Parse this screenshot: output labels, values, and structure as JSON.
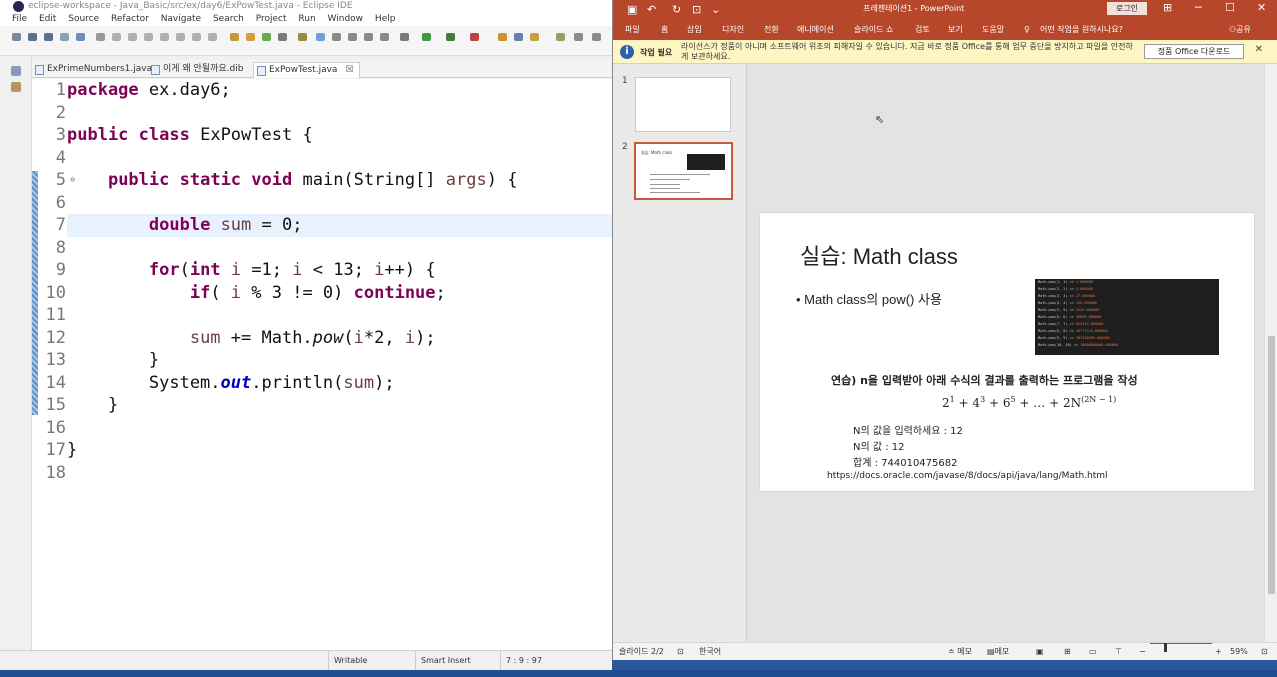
{
  "eclipse": {
    "title": "eclipse-workspace - Java_Basic/src/ex/day6/ExPowTest.java - Eclipse IDE",
    "menu": [
      "File",
      "Edit",
      "Source",
      "Refactor",
      "Navigate",
      "Search",
      "Project",
      "Run",
      "Window",
      "Help"
    ],
    "tabs": [
      {
        "label": "ExPrimeNumbers1.java"
      },
      {
        "label": "이게 왜 안될까요.dib"
      },
      {
        "label": "ExPowTest.java",
        "close": "☒"
      }
    ],
    "line_numbers": [
      "1",
      "2",
      "3",
      "4",
      "5",
      "6",
      "7",
      "8",
      "9",
      "10",
      "11",
      "12",
      "13",
      "14",
      "15",
      "16",
      "17",
      "18"
    ],
    "fold_marker": "⊖",
    "status": {
      "writable": "Writable",
      "insert_mode": "Smart Insert",
      "position": "7 : 9 : 97"
    }
  },
  "ppt": {
    "doc_title": "프레젠테이션1 - PowerPoint",
    "login": "로그인",
    "ribbon_tabs": [
      "파일",
      "홈",
      "삽입",
      "디자인",
      "전환",
      "애니메이션",
      "슬라이드 쇼",
      "검토",
      "보기",
      "도움말"
    ],
    "tell_me": "어떤 작업을 원하시나요?",
    "share": "공유",
    "warning": {
      "title": "작업 필요",
      "message": "라이선스가 정품이 아니며 소프트웨어 위조의 피해자일 수 있습니다. 지금 바로 정품 Office를 통해 업무 중단을 방지하고 파일을 안전하게 보관하세요.",
      "button": "정품 Office 다운로드",
      "close": "✕"
    },
    "thumbnails": [
      {
        "number": "1"
      },
      {
        "number": "2",
        "mini_title": "실습: Math class"
      }
    ],
    "slide": {
      "title": "실습: Math class",
      "bullet": "• Math class의 pow() 사용",
      "console_lines": [
        [
          "Math.pow(1, 1) => ",
          "1.000000"
        ],
        [
          "Math.pow(2, 2) => ",
          "4.000000"
        ],
        [
          "Math.pow(3, 3) => ",
          "27.000000"
        ],
        [
          "Math.pow(4, 4) => ",
          "256.000000"
        ],
        [
          "Math.pow(5, 5) => ",
          "3125.000000"
        ],
        [
          "Math.pow(6, 6) => ",
          "46656.000000"
        ],
        [
          "Math.pow(7, 7) => ",
          "823543.000000"
        ],
        [
          "Math.pow(8, 8) => ",
          "16777216.000000"
        ],
        [
          "Math.pow(9, 9) => ",
          "387420489.000000"
        ],
        [
          "Math.pow(10, 10) => ",
          "10000000000.000000"
        ]
      ],
      "exercise": "연습) n을 입력받아 아래 수식의 결과를 출력하는 프로그램을 작성",
      "formula": {
        "t1": "2",
        "e1": "1",
        "t2": " + 4",
        "e2": "3",
        "t3": " + 6",
        "e3": "5",
        "t4": " + … + 2N",
        "e4": "(2N − 1)"
      },
      "output": [
        "N의 값을 입력하세요 : 12",
        "N의 값 : 12",
        "합계 : 744010475682"
      ],
      "link": "https://docs.oracle.com/javase/8/docs/api/java/lang/Math.html"
    },
    "status": {
      "slide": "슬라이드 2/2",
      "lang": "한국어",
      "notes": "≐ 메모",
      "comments": "메모",
      "zoom": "59%"
    }
  }
}
